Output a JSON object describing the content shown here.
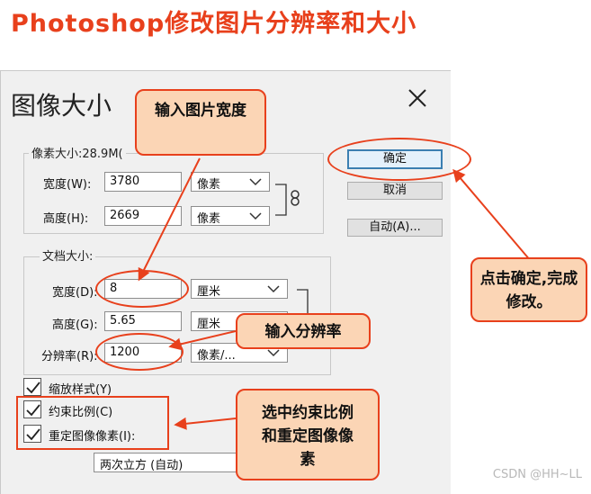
{
  "headline": "Photoshop修改图片分辨率和大小",
  "dialog": {
    "title": "图像大小",
    "pixel_dimensions_label": "像素大小:28.9M(",
    "width_label": "宽度(W):",
    "width_value": "3780",
    "width_unit": "像素",
    "height_label": "高度(H):",
    "height_value": "2669",
    "height_unit": "像素",
    "document_size_label": "文档大小:",
    "doc_width_label": "宽度(D):",
    "doc_width_value": "8",
    "doc_width_unit": "厘米",
    "doc_height_label": "高度(G):",
    "doc_height_value": "5.65",
    "doc_height_unit": "厘米",
    "resolution_label": "分辨率(R):",
    "resolution_value": "1200",
    "resolution_unit": "像素/...",
    "scale_styles_label": "缩放样式(Y)",
    "constrain_label": "约束比例(C)",
    "resample_label": "重定图像像素(I):",
    "resample_method": "两次立方 (自动)",
    "ok_label": "确定",
    "cancel_label": "取消",
    "auto_label": "自动(A)..."
  },
  "callouts": {
    "input_width": "输入图片宽度",
    "click_ok": "点击确定,完成修改。",
    "input_resolution": "输入分辨率",
    "check_options": "选中约束比例和重定图像像素"
  },
  "watermark": "CSDN @HH~LL",
  "colors": {
    "accent": "#e8401c",
    "callout_fill": "#fbd5b5",
    "dialog_bg": "#f0f0f0"
  }
}
